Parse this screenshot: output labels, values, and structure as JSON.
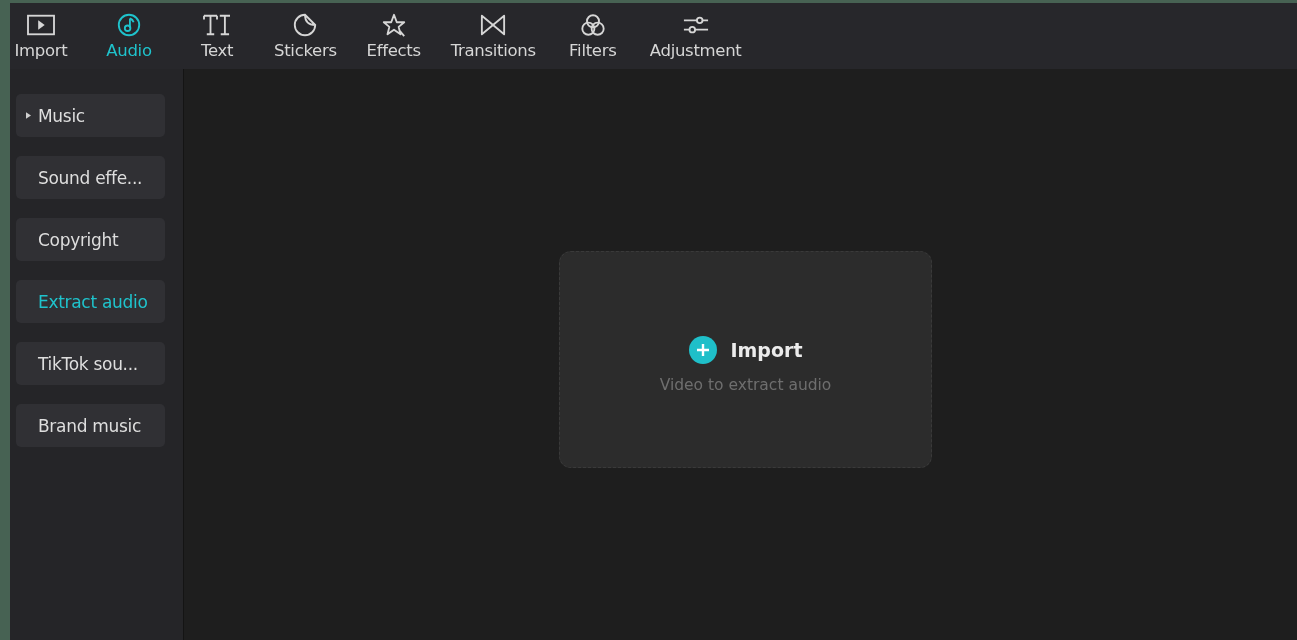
{
  "toolbar": {
    "tabs": [
      {
        "label": "Import",
        "kind": "media",
        "selected": false
      },
      {
        "label": "Audio",
        "kind": "audio",
        "selected": true
      },
      {
        "label": "Text",
        "kind": "text",
        "selected": false
      },
      {
        "label": "Stickers",
        "kind": "stickers",
        "selected": false
      },
      {
        "label": "Effects",
        "kind": "effects",
        "selected": false
      },
      {
        "label": "Transitions",
        "kind": "transitions",
        "selected": false
      },
      {
        "label": "Filters",
        "kind": "filters",
        "selected": false
      },
      {
        "label": "Adjustment",
        "kind": "adjustment",
        "selected": false
      }
    ]
  },
  "sidebar": {
    "items": [
      {
        "label": "Music",
        "kind": "group",
        "selected": false
      },
      {
        "label": "Sound effe...",
        "kind": "plain",
        "selected": false
      },
      {
        "label": "Copyright",
        "kind": "plain",
        "selected": false
      },
      {
        "label": "Extract audio",
        "kind": "plain",
        "selected": true
      },
      {
        "label": "TikTok sou...",
        "kind": "plain",
        "selected": false
      },
      {
        "label": "Brand music",
        "kind": "plain",
        "selected": false
      }
    ]
  },
  "import_card": {
    "title": "Import",
    "hint": "Video to extract audio"
  }
}
